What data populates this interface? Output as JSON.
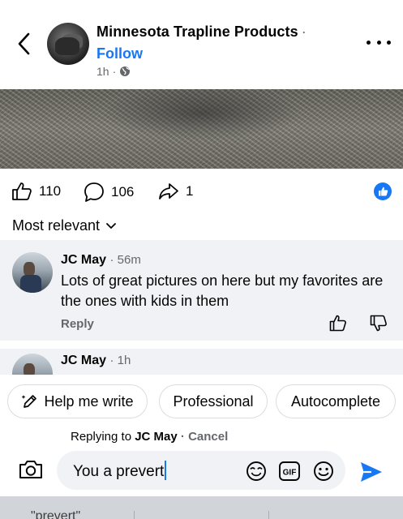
{
  "header": {
    "page_name": "Minnesota Trapline Products",
    "name_dot": "·",
    "follow_label": "Follow",
    "post_time": "1h",
    "meta_dot": "·",
    "privacy_icon": "globe-icon"
  },
  "reactions": {
    "like_count": "110",
    "comment_count": "106",
    "share_count": "1",
    "badge_color": "#1877f2"
  },
  "sort": {
    "label": "Most relevant"
  },
  "comments": [
    {
      "author": "JC May",
      "time": "· 56m",
      "text": "Lots of great pictures on here but my favorites are the ones with kids in them",
      "reply_label": "Reply"
    },
    {
      "author": "JC May",
      "time": "· 1h"
    }
  ],
  "composer": {
    "chips": [
      "Help me write",
      "Professional",
      "Autocomplete"
    ],
    "replying_prefix": "Replying to",
    "replying_name": "JC May",
    "cancel_label": "· Cancel",
    "input_value": "You a prevert",
    "accent": "#1877f2"
  },
  "keyboard": {
    "suggestions": [
      "\"prevert\""
    ]
  }
}
